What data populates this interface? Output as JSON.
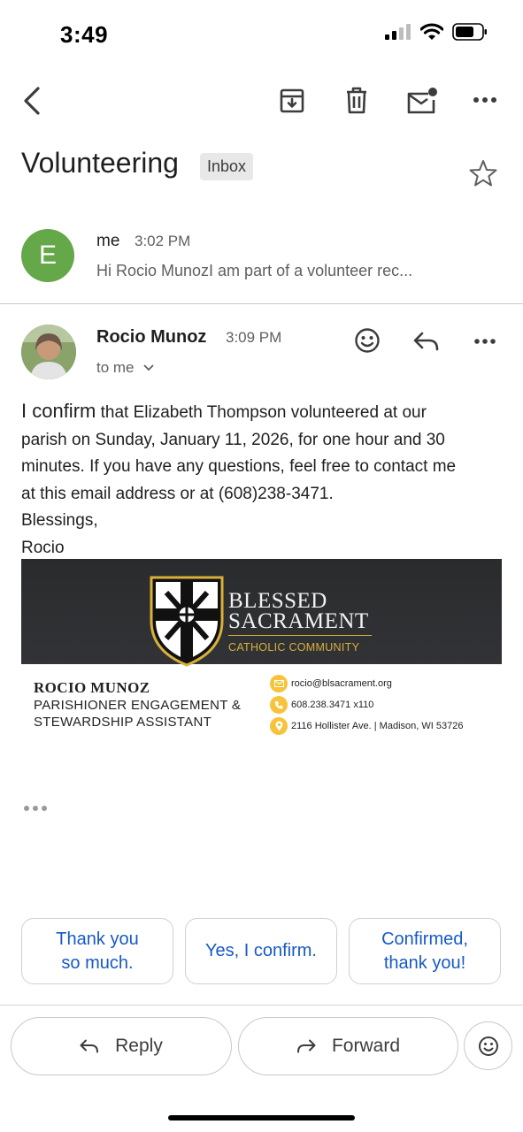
{
  "status_bar": {
    "time": "3:49",
    "icons": [
      "cellular-icon",
      "wifi-icon",
      "battery-icon"
    ]
  },
  "toolbar": {
    "icons": [
      "back-arrow-icon",
      "archive-icon",
      "trash-icon",
      "mark-unread-icon",
      "more-icon"
    ]
  },
  "thread": {
    "subject": "Volunteering",
    "label": "Inbox"
  },
  "messages": [
    {
      "avatar_letter": "E",
      "avatar_color": "#65a84a",
      "sender": "me",
      "time": "3:02 PM",
      "snippet": "Hi Rocio MunozI am part of a volunteer rec..."
    },
    {
      "sender": "Rocio Munoz",
      "time": "3:09 PM",
      "recipients": "to me",
      "body": {
        "lead": "I confirm",
        "line1": " that Elizabeth Thompson volunteered at our",
        "line2": "parish on Sunday, January 11, 2026, for one hour and 30",
        "line3": "minutes. If you have any questions, feel free to contact me",
        "line4": "at this email address or at (608)238-3471.",
        "line5": "Blessings,",
        "line6": "Rocio"
      },
      "signature": {
        "banner_line1": "BLESSED",
        "banner_line2": "SACRAMENT",
        "banner_sub": "CATHOLIC COMMUNITY",
        "name": "ROCIO MUNOZ",
        "role_line1": "PARISHIONER ENGAGEMENT &",
        "role_line2": "STEWARDSHIP ASSISTANT",
        "email": "rocio@blsacrament.org",
        "phone": "608.238.3471 x110",
        "address": "2116 Hollister Ave. | Madison, WI  53726"
      }
    }
  ],
  "smart_replies": [
    {
      "line1": "Thank you",
      "line2": "so much."
    },
    {
      "line1": "Yes, I confirm.",
      "line2": ""
    },
    {
      "line1": "Confirmed,",
      "line2": "thank you!"
    }
  ],
  "actions": {
    "reply": "Reply",
    "forward": "Forward"
  },
  "colors": {
    "link_blue": "#1759c6",
    "accent_gold": "#f6c33b"
  }
}
